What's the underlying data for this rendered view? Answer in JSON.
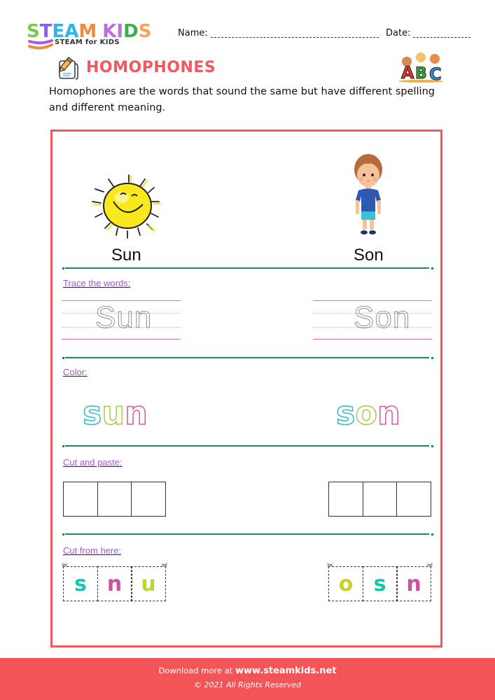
{
  "header": {
    "logo_letters": [
      {
        "ch": "S",
        "color": "#7bc950"
      },
      {
        "ch": "T",
        "color": "#8b5cf6"
      },
      {
        "ch": "E",
        "color": "#2fb5e8"
      },
      {
        "ch": "A",
        "color": "#2fb5e8"
      },
      {
        "ch": "M",
        "color": "#f08a3c"
      },
      {
        "ch": " ",
        "color": "#ffffff"
      },
      {
        "ch": "K",
        "color": "#c06be0"
      },
      {
        "ch": "I",
        "color": "#c06be0"
      },
      {
        "ch": "D",
        "color": "#36b24a"
      },
      {
        "ch": "S",
        "color": "#f7a25c"
      }
    ],
    "logo_tagline": "STEAM for KIDS",
    "name_label": "Name:",
    "date_label": "Date:"
  },
  "worksheet": {
    "title": "HOMOPHONES",
    "title_color": "#f05a5f",
    "intro": "Homophones are the words that sound the same but have different spelling and different meaning.",
    "words": [
      {
        "word": "Sun",
        "image": "sun-illustration"
      },
      {
        "word": "Son",
        "image": "boy-illustration"
      }
    ],
    "sections": {
      "trace": "Trace the words:",
      "color": "Color:",
      "cut_paste": "Cut and paste:",
      "cut_from": "Cut from here:"
    },
    "trace_words": [
      "Sun",
      "Son"
    ],
    "color_words": [
      {
        "letters": [
          {
            "ch": "s",
            "color": "#35b8c4"
          },
          {
            "ch": "u",
            "color": "#a9c94a"
          },
          {
            "ch": "n",
            "color": "#d05aa8"
          }
        ]
      },
      {
        "letters": [
          {
            "ch": "s",
            "color": "#35b8c4"
          },
          {
            "ch": "o",
            "color": "#a9c94a"
          },
          {
            "ch": "n",
            "color": "#d05aa8"
          }
        ]
      }
    ],
    "paste_boxes": [
      3,
      3
    ],
    "cut_tiles": [
      [
        {
          "ch": "s",
          "color": "#18c3b4"
        },
        {
          "ch": "n",
          "color": "#d04fa0"
        },
        {
          "ch": "u",
          "color": "#b9d832"
        }
      ],
      [
        {
          "ch": "o",
          "color": "#c9d128"
        },
        {
          "ch": "s",
          "color": "#18c3b4"
        },
        {
          "ch": "n",
          "color": "#d04fa0"
        }
      ]
    ]
  },
  "footer": {
    "download_prefix": "Download more at",
    "site": "www.steamkids.net",
    "copyright": "© 2021 All Rights Reserved",
    "color": "#f25458"
  }
}
